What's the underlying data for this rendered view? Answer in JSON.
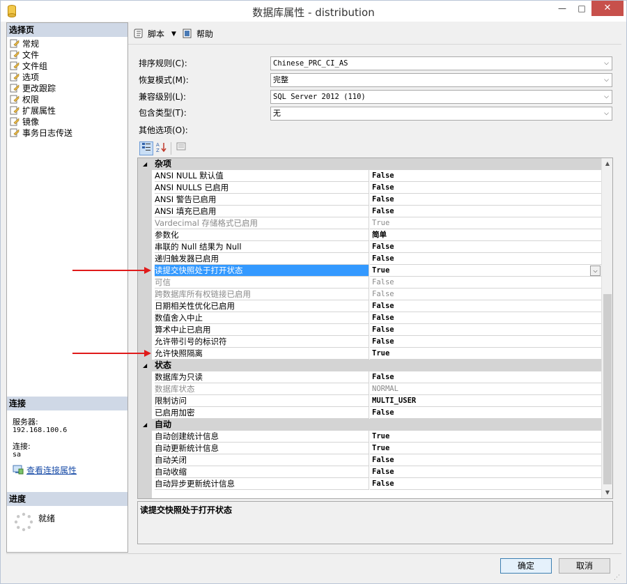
{
  "window": {
    "title": "数据库属性 - distribution",
    "min_glyph": "—",
    "max_glyph": "□",
    "close_glyph": "✕"
  },
  "left_pane": {
    "select_page_header": "选择页",
    "pages": [
      "常规",
      "文件",
      "文件组",
      "选项",
      "更改跟踪",
      "权限",
      "扩展属性",
      "镜像",
      "事务日志传送"
    ],
    "connection_header": "连接",
    "server_label": "服务器:",
    "server_value": "192.168.100.6",
    "connection_label": "连接:",
    "connection_value": "sa",
    "view_connection_link": "查看连接属性",
    "progress_header": "进度",
    "progress_status": "就绪"
  },
  "toolbar": {
    "script_label": "脚本",
    "help_label": "帮助"
  },
  "fields": {
    "collation_label": "排序规则(C):",
    "collation_value": "Chinese_PRC_CI_AS",
    "recovery_label": "恢复模式(M):",
    "recovery_value": "完整",
    "compat_label": "兼容级别(L):",
    "compat_value": "SQL Server 2012 (110)",
    "containment_label": "包含类型(T):",
    "containment_value": "无",
    "other_options_label": "其他选项(O):"
  },
  "grid": {
    "categories": [
      {
        "name": "杂项",
        "rows": [
          {
            "name": "ANSI NULL 默认值",
            "value": "False",
            "state": "normal"
          },
          {
            "name": "ANSI NULLS 已启用",
            "value": "False",
            "state": "normal"
          },
          {
            "name": "ANSI 警告已启用",
            "value": "False",
            "state": "normal"
          },
          {
            "name": "ANSI 填充已启用",
            "value": "False",
            "state": "normal"
          },
          {
            "name": "Vardecimal 存储格式已启用",
            "value": "True",
            "state": "disabled"
          },
          {
            "name": "参数化",
            "value": "简单",
            "state": "normal"
          },
          {
            "name": "串联的 Null 结果为 Null",
            "value": "False",
            "state": "normal"
          },
          {
            "name": "递归触发器已启用",
            "value": "False",
            "state": "normal"
          },
          {
            "name": "读提交快照处于打开状态",
            "value": "True",
            "state": "selected"
          },
          {
            "name": "可信",
            "value": "False",
            "state": "disabled"
          },
          {
            "name": "跨数据库所有权链接已启用",
            "value": "False",
            "state": "disabled"
          },
          {
            "name": "日期相关性优化已启用",
            "value": "False",
            "state": "normal"
          },
          {
            "name": "数值舍入中止",
            "value": "False",
            "state": "normal"
          },
          {
            "name": "算术中止已启用",
            "value": "False",
            "state": "normal"
          },
          {
            "name": "允许带引号的标识符",
            "value": "False",
            "state": "normal"
          },
          {
            "name": "允许快照隔离",
            "value": "True",
            "state": "normal"
          }
        ]
      },
      {
        "name": "状态",
        "rows": [
          {
            "name": "数据库为只读",
            "value": "False",
            "state": "normal"
          },
          {
            "name": "数据库状态",
            "value": "NORMAL",
            "state": "disabled"
          },
          {
            "name": "限制访问",
            "value": "MULTI_USER",
            "state": "normal"
          },
          {
            "name": "已启用加密",
            "value": "False",
            "state": "normal"
          }
        ]
      },
      {
        "name": "自动",
        "rows": [
          {
            "name": "自动创建统计信息",
            "value": "True",
            "state": "normal"
          },
          {
            "name": "自动更新统计信息",
            "value": "True",
            "state": "normal"
          },
          {
            "name": "自动关闭",
            "value": "False",
            "state": "normal"
          },
          {
            "name": "自动收缩",
            "value": "False",
            "state": "normal"
          },
          {
            "name": "自动异步更新统计信息",
            "value": "False",
            "state": "normal"
          }
        ]
      }
    ]
  },
  "description": "读提交快照处于打开状态",
  "buttons": {
    "ok": "确定",
    "cancel": "取消"
  },
  "colors": {
    "selection": "#3399ff",
    "annotation_arrow": "#e01a1a",
    "header_bg": "#cfd8e6"
  }
}
